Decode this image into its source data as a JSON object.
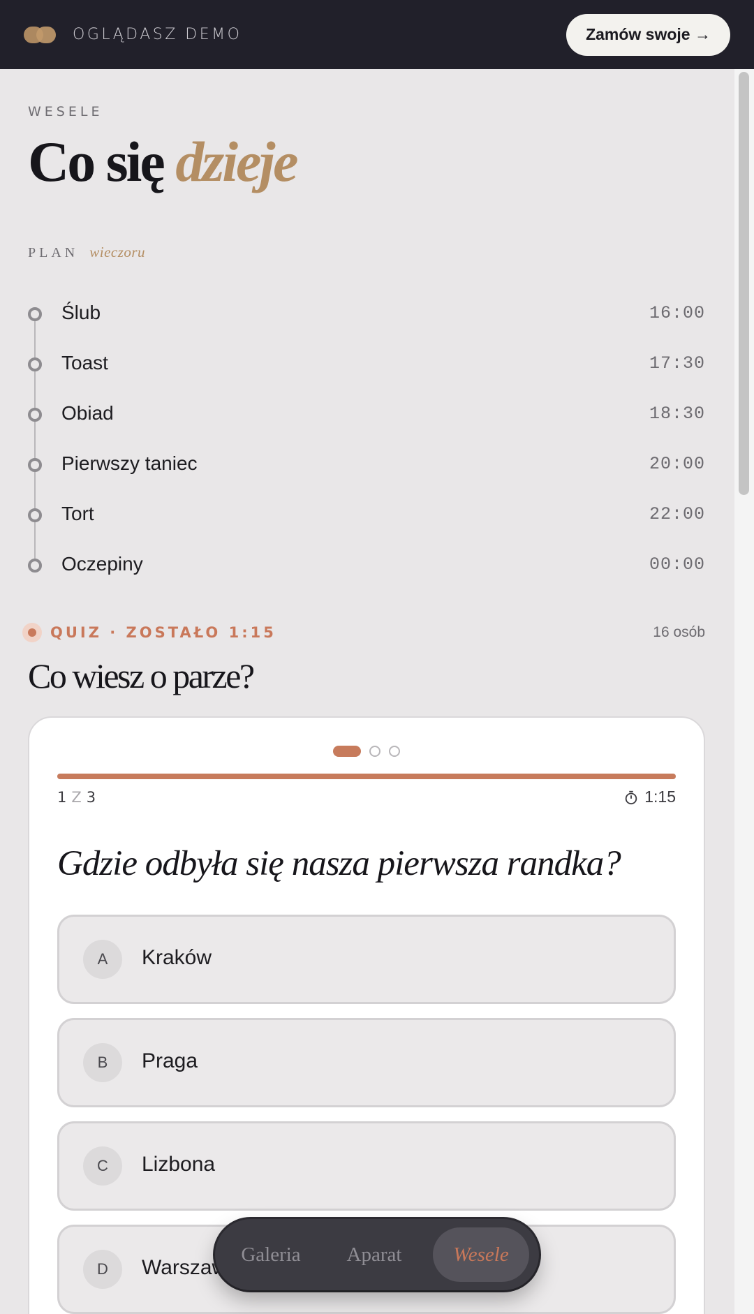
{
  "topbar": {
    "demo_label": "OGLĄDASZ DEMO",
    "order_button": "Zamów swoje →"
  },
  "header": {
    "eyebrow": "WESELE",
    "title_main": "Co się",
    "title_accent": "dzieje"
  },
  "plan": {
    "label": "PLAN",
    "label_accent": "wieczoru",
    "items": [
      {
        "name": "Ślub",
        "time": "16:00"
      },
      {
        "name": "Toast",
        "time": "17:30"
      },
      {
        "name": "Obiad",
        "time": "18:30"
      },
      {
        "name": "Pierwszy taniec",
        "time": "20:00"
      },
      {
        "name": "Tort",
        "time": "22:00"
      },
      {
        "name": "Oczepiny",
        "time": "00:00"
      }
    ]
  },
  "quiz": {
    "status": "QUIZ · ZOSTAŁO 1:15",
    "participants": "16 osób",
    "title": "Co wiesz o parze?",
    "current": "1",
    "separator": "Z",
    "total": "3",
    "progress": 1.0,
    "timer": "1:15",
    "question": "Gdzie odbyła się nasza pierwsza randka?",
    "answers": [
      {
        "letter": "A",
        "text": "Kraków"
      },
      {
        "letter": "B",
        "text": "Praga"
      },
      {
        "letter": "C",
        "text": "Lizbona"
      },
      {
        "letter": "D",
        "text": "Warszawa"
      }
    ]
  },
  "nav": {
    "items": [
      "Galeria",
      "Aparat",
      "Wesele"
    ],
    "active": "Wesele"
  },
  "colors": {
    "accent_gold": "#b48e63",
    "accent_terracotta": "#c77b5c",
    "topbar_bg": "#21202a"
  }
}
